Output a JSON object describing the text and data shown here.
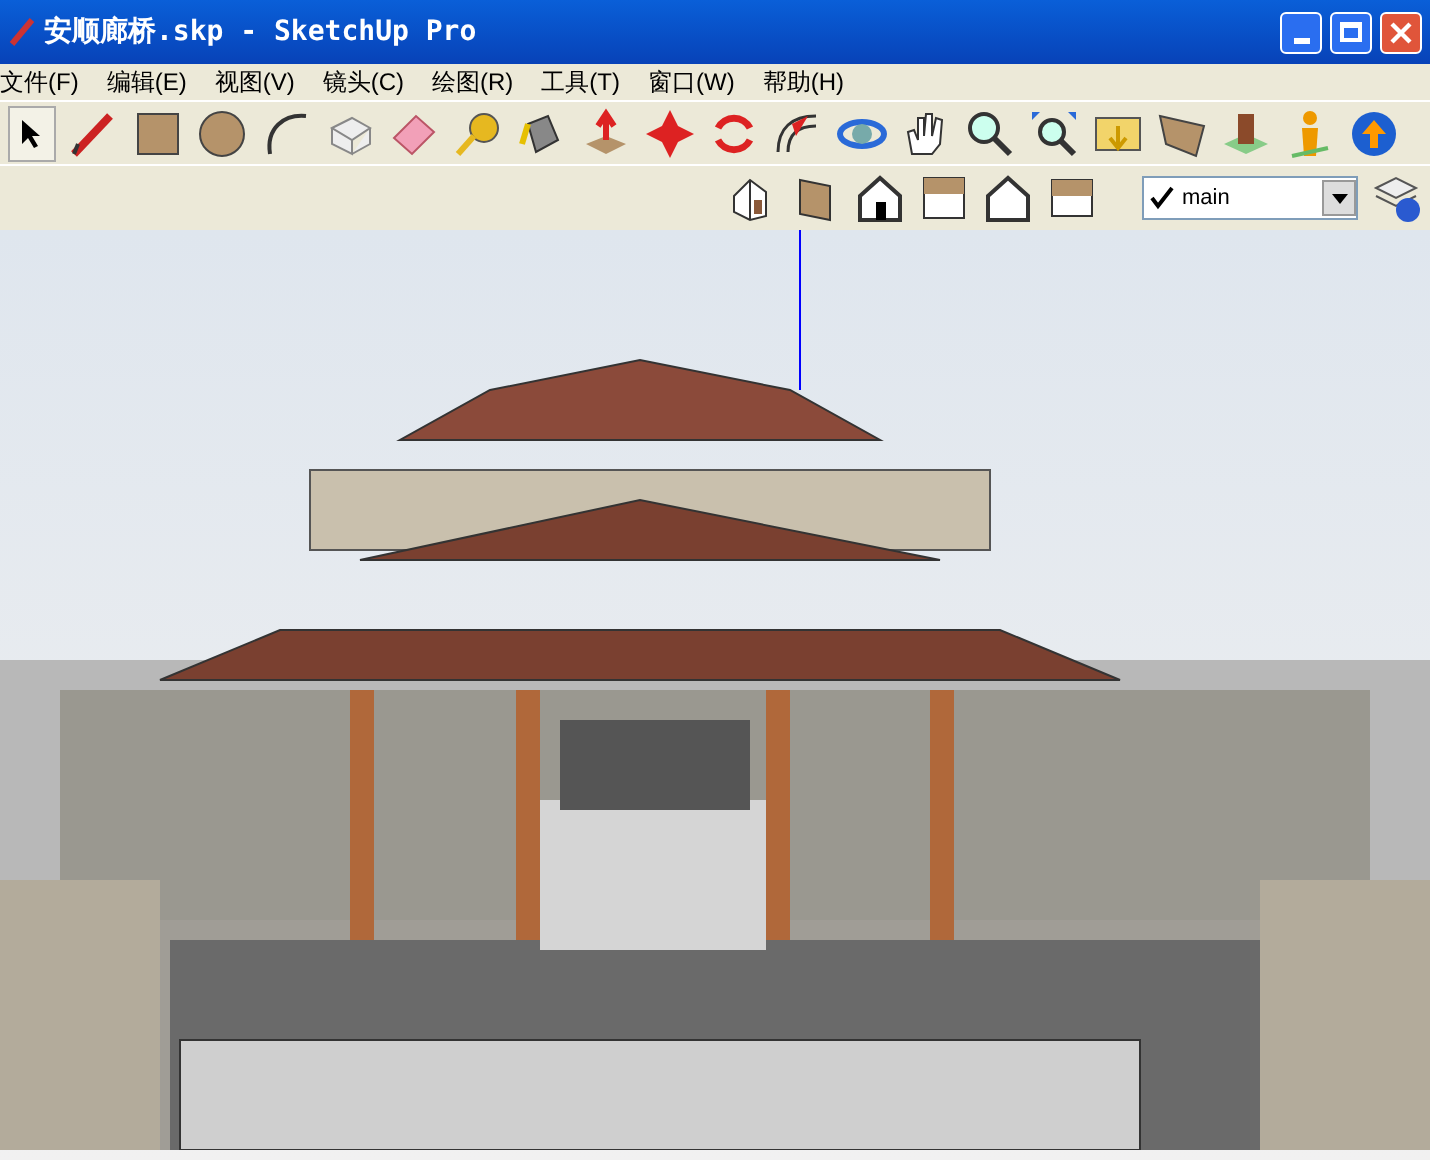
{
  "window": {
    "title": "安顺廊桥.skp - SketchUp Pro"
  },
  "menu": [
    "文件(F)",
    "编辑(E)",
    "视图(V)",
    "镜头(C)",
    "绘图(R)",
    "工具(T)",
    "窗口(W)",
    "帮助(H)"
  ],
  "layer_dropdown": {
    "checked": true,
    "value": "main"
  }
}
